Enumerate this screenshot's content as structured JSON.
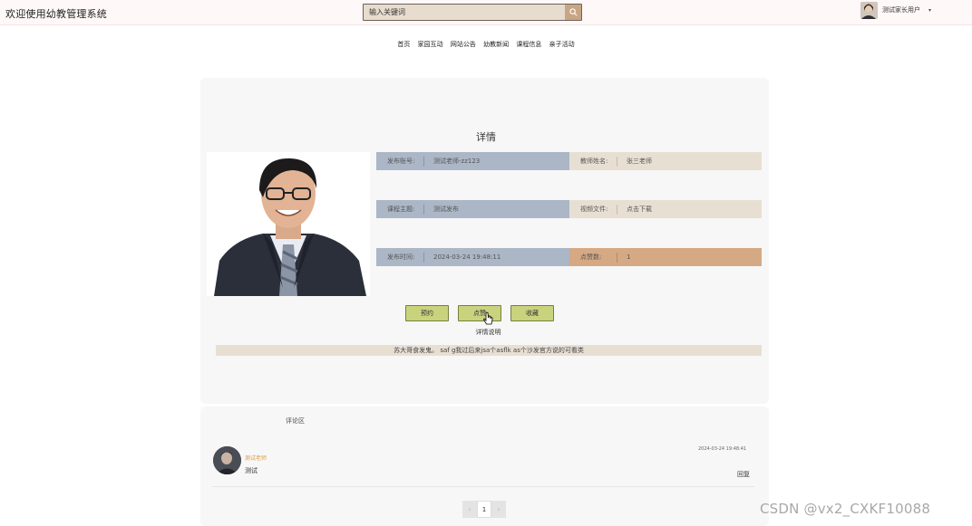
{
  "header": {
    "site_title": "欢迎使用幼教管理系统",
    "search_placeholder": "输入关键词",
    "search_icon": "search-icon",
    "user_name": "测试家长用户",
    "user_caret": "▾"
  },
  "nav": {
    "items": [
      "首页",
      "家园互动",
      "网站公告",
      "幼教新闻",
      "课程信息",
      "亲子活动"
    ]
  },
  "detail": {
    "title": "详情",
    "fields": {
      "publisher_label": "发布账号:",
      "publisher_value": "测试老师-zz123",
      "teacher_label": "教师姓名:",
      "teacher_value": "张三老师",
      "topic_label": "课程主题:",
      "topic_value": "测试发布",
      "video_label": "视频文件:",
      "video_value": "点击下载",
      "time_label": "发布时间:",
      "time_value": "2024-03-24 19:48:11",
      "likes_label": "点赞数:",
      "likes_value": "1"
    },
    "buttons": {
      "reserve": "预约",
      "like": "点赞",
      "favorite": "收藏"
    },
    "description_label": "详情说明",
    "description_text": "苏大哥食发鬼。 saf g我过后来jsa个asflk as个沙发官方说的可看类"
  },
  "comments": {
    "title": "评论区",
    "items": [
      {
        "author": "测试老师",
        "text": "测试",
        "time": "2024-03-24 19:48:41",
        "reply_label": "回复"
      }
    ]
  },
  "pagination": {
    "prev": "‹",
    "current": "1",
    "next": "›"
  },
  "watermark": "CSDN @vx2_CXKF10088",
  "colors": {
    "field_blue": "#abb7c6",
    "field_beige": "#e8dfd3",
    "field_tan": "#d5a984",
    "button_green": "#c9d37e",
    "author_orange": "#e09a3a"
  }
}
